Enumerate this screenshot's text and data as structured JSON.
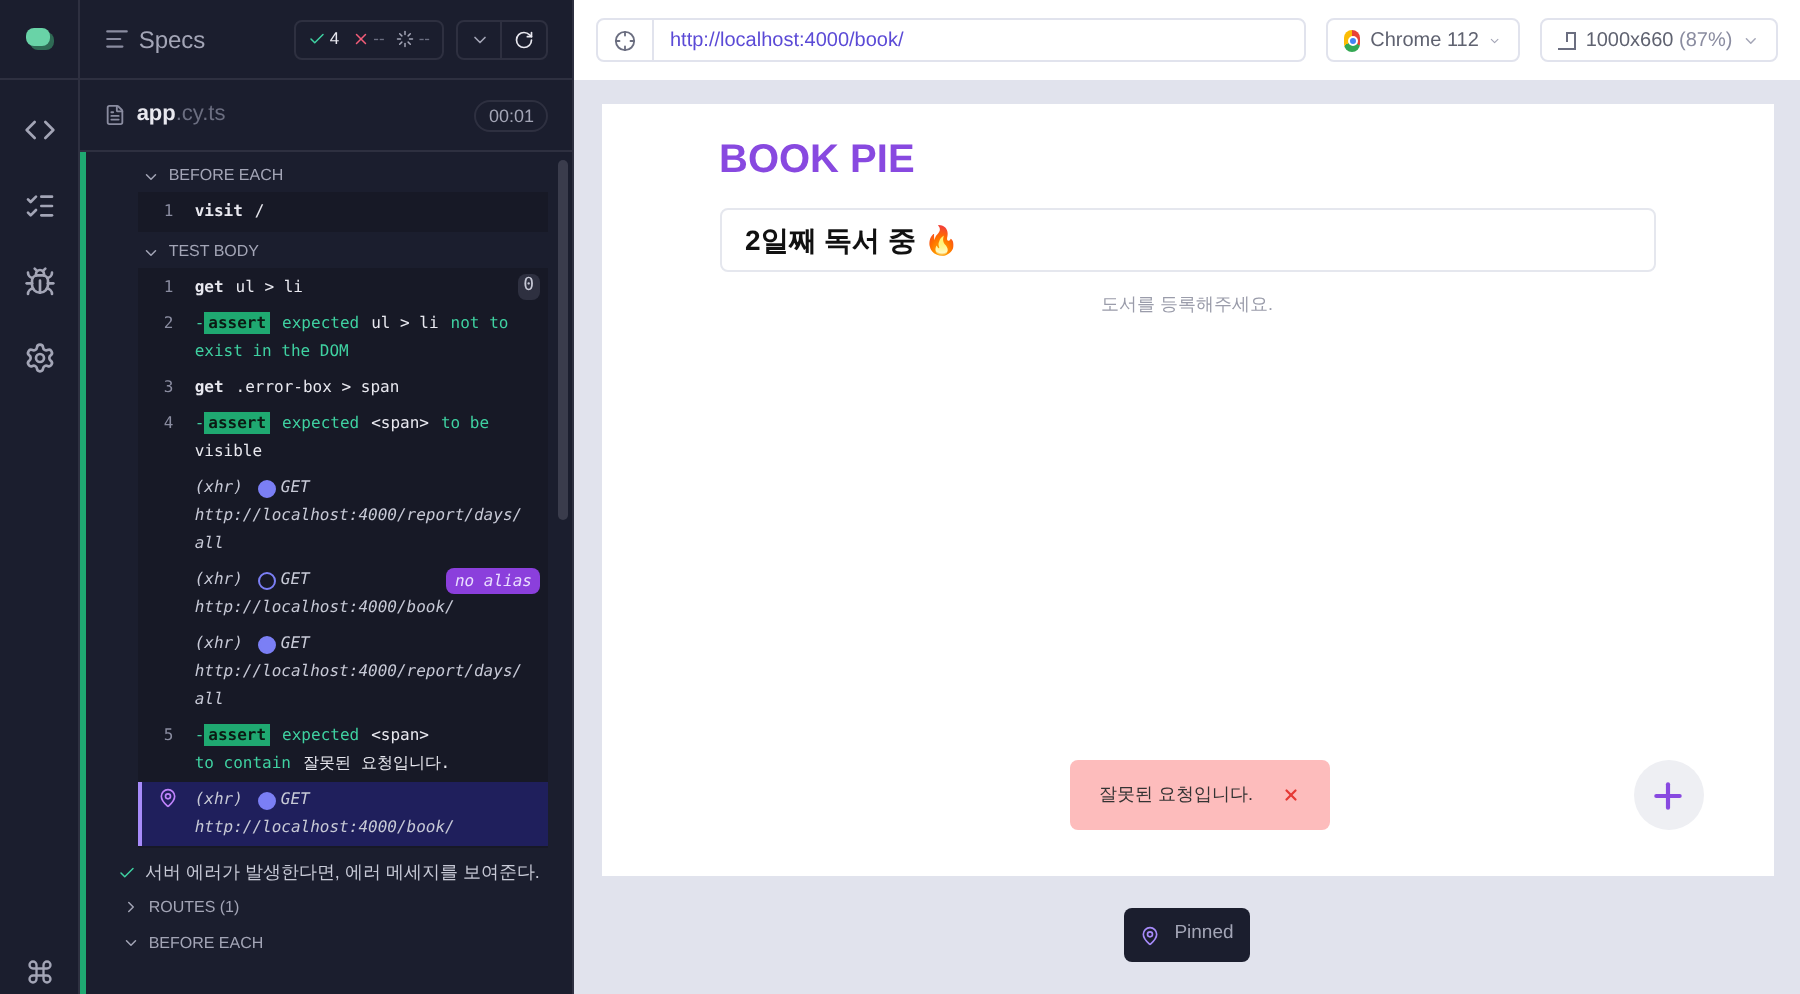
{
  "specs_header": {
    "title": "Specs",
    "passed": "4",
    "failed": "--",
    "pending": "--"
  },
  "spec_file": {
    "name": "app",
    "ext": ".cy.ts",
    "duration": "00:01"
  },
  "hooks": [
    {
      "label": "BEFORE EACH",
      "expanded": true,
      "commands": [
        {
          "kind": "command",
          "number": "1",
          "name": "visit",
          "parts": [
            {
              "text": "/",
              "kind": "value"
            }
          ]
        }
      ]
    },
    {
      "label": "TEST BODY",
      "expanded": true,
      "commands": [
        {
          "kind": "command",
          "number": "1",
          "name": "get",
          "parts": [
            {
              "text": "ul > li",
              "kind": "value"
            }
          ],
          "count": "0"
        },
        {
          "kind": "assert",
          "number": "2",
          "marker": "-",
          "name": "assert",
          "parts": [
            {
              "text": "expected",
              "kind": "keyword"
            },
            {
              "text": "ul > li",
              "kind": "value"
            },
            {
              "text": "not to",
              "kind": "keyword"
            },
            {
              "text": "exist in the DOM",
              "kind": "keyword"
            }
          ]
        },
        {
          "kind": "command",
          "number": "3",
          "name": "get",
          "parts": [
            {
              "text": ".error-box > span",
              "kind": "value"
            }
          ]
        },
        {
          "kind": "assert",
          "number": "4",
          "marker": "-",
          "name": "assert",
          "parts": [
            {
              "text": "expected",
              "kind": "keyword"
            },
            {
              "text": "<span>",
              "kind": "value"
            },
            {
              "text": "to be",
              "kind": "keyword"
            },
            {
              "text": "visible",
              "kind": "value"
            }
          ]
        },
        {
          "kind": "xhr",
          "type": "(xhr)",
          "method": "GET",
          "url": "http://localhost:4000/report/days/all",
          "matched": true,
          "pinned": false
        },
        {
          "kind": "xhr",
          "type": "(xhr)",
          "method": "GET",
          "url": "http://localhost:4000/book/",
          "matched": false,
          "alias": "no alias",
          "pinned": false
        },
        {
          "kind": "xhr",
          "type": "(xhr)",
          "method": "GET",
          "url": "http://localhost:4000/report/days/all",
          "matched": true,
          "pinned": false
        },
        {
          "kind": "assert",
          "number": "5",
          "marker": "-",
          "name": "assert",
          "parts": [
            {
              "text": "expected",
              "kind": "keyword"
            },
            {
              "text": "<span>",
              "kind": "value"
            },
            {
              "text": "to contain",
              "kind": "keyword"
            },
            {
              "text": "잘못된 요청입니다.",
              "kind": "value"
            }
          ]
        },
        {
          "kind": "xhr",
          "type": "(xhr)",
          "method": "GET",
          "url": "http://localhost:4000/book/",
          "matched": true,
          "pinned": true
        }
      ]
    }
  ],
  "next_test": {
    "title": "서버 에러가 발생한다면, 에러 메세지를 보여준다.",
    "passed": true,
    "sections": [
      {
        "label": "ROUTES (1)",
        "expanded": false
      },
      {
        "label": "BEFORE EACH",
        "expanded": true
      }
    ]
  },
  "toolbar": {
    "url": "http://localhost:4000/book/",
    "browser": "Chrome 112",
    "viewport": "1000x660",
    "scale": "(87%)"
  },
  "app": {
    "title": "BOOK PIE",
    "banner": "2일째 독서 중 🔥",
    "empty_message": "도서를 등록해주세요.",
    "toast": "잘못된 요청입니다."
  },
  "pinned_label": "Pinned"
}
